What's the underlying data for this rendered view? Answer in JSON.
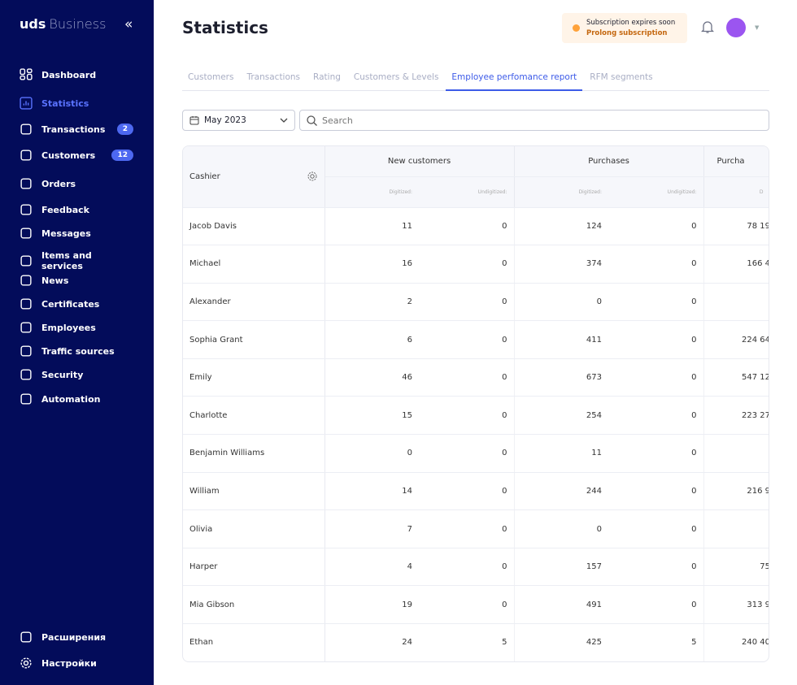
{
  "sidebar": {
    "logo_main": "uds",
    "logo_sub": "Business",
    "items": [
      {
        "label": "Dashboard",
        "icon": "dashboard-icon"
      },
      {
        "label": "Statistics",
        "icon": "chart-icon",
        "active": true
      },
      {
        "label": "Transactions",
        "icon": "wallet-icon",
        "badge": "2"
      },
      {
        "label": "Customers",
        "icon": "users-icon",
        "badge": "12"
      },
      {
        "label": "Orders",
        "icon": "inbox-icon"
      },
      {
        "label": "Feedback",
        "icon": "feedback-icon"
      },
      {
        "label": "Messages",
        "icon": "message-icon"
      },
      {
        "label": "Items and services",
        "icon": "bag-icon"
      },
      {
        "label": "News",
        "icon": "news-icon"
      },
      {
        "label": "Certificates",
        "icon": "ticket-icon"
      },
      {
        "label": "Employees",
        "icon": "person-icon"
      },
      {
        "label": "Traffic sources",
        "icon": "globe-icon"
      },
      {
        "label": "Security",
        "icon": "shield-icon"
      },
      {
        "label": "Automation",
        "icon": "robot-icon"
      }
    ],
    "bottom": [
      {
        "label": "Расширения",
        "icon": "extensions-icon"
      },
      {
        "label": "Настройки",
        "icon": "gear-icon"
      }
    ]
  },
  "header": {
    "title": "Statistics",
    "subscription_text": "Subscription expires soon",
    "subscription_link": "Prolong subscription"
  },
  "tabs": [
    "Customers",
    "Transactions",
    "Rating",
    "Customers & Levels",
    "Employee perfomance report",
    "RFM segments"
  ],
  "active_tab": 4,
  "filters": {
    "month": "May 2023",
    "search_placeholder": "Search"
  },
  "table": {
    "cashier_header": "Cashier",
    "groups": [
      "New customers",
      "Purchases",
      "Purcha"
    ],
    "sub": [
      "Digitized:",
      "Undigitized:",
      "Digitized:",
      "Undigitized:",
      "D"
    ],
    "rows": [
      [
        "Jacob Davis",
        "11",
        "0",
        "124",
        "0",
        "78 19"
      ],
      [
        "Michael",
        "16",
        "0",
        "374",
        "0",
        "166 4"
      ],
      [
        "Alexander",
        "2",
        "0",
        "0",
        "0",
        ""
      ],
      [
        "Sophia Grant",
        "6",
        "0",
        "411",
        "0",
        "224 64"
      ],
      [
        "Emily",
        "46",
        "0",
        "673",
        "0",
        "547 12"
      ],
      [
        "Charlotte",
        "15",
        "0",
        "254",
        "0",
        "223 27"
      ],
      [
        "Benjamin Williams",
        "0",
        "0",
        "11",
        "0",
        ""
      ],
      [
        "William",
        "14",
        "0",
        "244",
        "0",
        "216 9"
      ],
      [
        "Olivia",
        "7",
        "0",
        "0",
        "0",
        ""
      ],
      [
        "Harper",
        "4",
        "0",
        "157",
        "0",
        "75"
      ],
      [
        "Mia Gibson",
        "19",
        "0",
        "491",
        "0",
        "313 9"
      ],
      [
        "Ethan",
        "24",
        "5",
        "425",
        "5",
        "240 40"
      ]
    ]
  },
  "colors": {
    "sidebar": "#030c5a",
    "accent": "#3d5be8",
    "badge": "#4d68f0",
    "warning": "#ffa23a",
    "avatar": "#9b55f0"
  }
}
